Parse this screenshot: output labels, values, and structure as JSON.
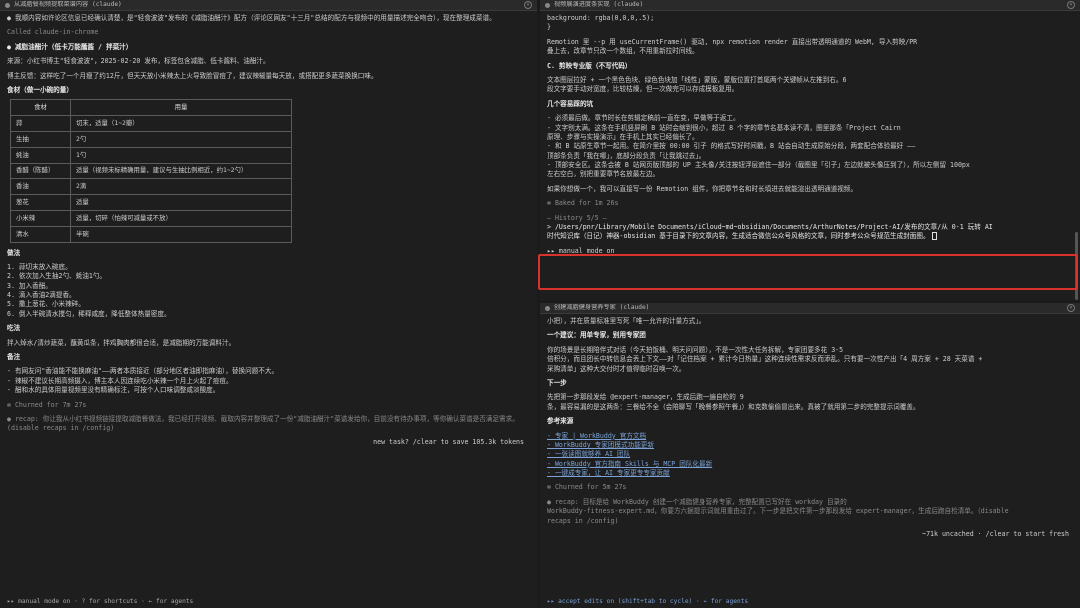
{
  "left_pane": {
    "title": "从减脂餐视频提取菜谱内容 (claude)",
    "lines": [
      {
        "t": "● 我顺内容如许论区信息已经确认清楚，是\"轻食波波\"发布的《减脂油醋汁》配方（评论区网友\"十三月\"总结的配方与视频中的用量描述完全吻合），现在整理成菜谱。",
        "c": "w"
      },
      {
        "t": "",
        "c": "gap"
      },
      {
        "t": "Called claude-in-chrome",
        "c": "dim"
      },
      {
        "t": "",
        "c": "gap"
      },
      {
        "t": "● 减脂油醋汁（低卡万能蘸酱 / 拌菜汁）",
        "c": "bold"
      },
      {
        "t": "",
        "c": "gap"
      },
      {
        "t": "来源：小红书博主\"轻食波波\"，2025-02-20 发布，标签包含减脂、低卡酱料、油醋汁。",
        "c": ""
      },
      {
        "t": "",
        "c": "gap"
      },
      {
        "t": "博主反馈：这样吃了一个月瘦了约12斤，但天天放小米辣太上火导致脸冒痘了，建议辣椒量每天放，或搭配更多蔬菜换换口味。",
        "c": ""
      },
      {
        "t": "",
        "c": "gap"
      },
      {
        "t": "食材（做一小碗的量）",
        "c": "bold"
      }
    ],
    "table": {
      "headers": [
        "食材",
        "用量"
      ],
      "rows": [
        [
          "蒜",
          "切末，适量（1~2瓣）"
        ],
        [
          "生抽",
          "2勺"
        ],
        [
          "蚝油",
          "1勺"
        ],
        [
          "香醋（陈醋）",
          "适量（视频未标精确用量，建议与生抽比例相近，约1~2勺）"
        ],
        [
          "香油",
          "2滴"
        ],
        [
          "葱花",
          "适量"
        ],
        [
          "小米辣",
          "适量，切碎（怕辣可减量或不放）"
        ],
        [
          "清水",
          "半碗"
        ]
      ]
    },
    "lines2": [
      {
        "t": "做法",
        "c": "bold"
      },
      {
        "t": "",
        "c": "gap"
      },
      {
        "t": "1. 蒜切末放入碗底。",
        "c": ""
      },
      {
        "t": "2. 依次加入生抽2勺、蚝油1勺。",
        "c": ""
      },
      {
        "t": "3. 加入香醋。",
        "c": ""
      },
      {
        "t": "4. 滴入香油2滴提香。",
        "c": ""
      },
      {
        "t": "5. 撒上葱花、小米辣碎。",
        "c": ""
      },
      {
        "t": "6. 倒入半碗清水搅匀，稀释咸度，降低整体热量密度。",
        "c": ""
      },
      {
        "t": "",
        "c": "gap"
      },
      {
        "t": "吃法",
        "c": "bold"
      },
      {
        "t": "",
        "c": "gap"
      },
      {
        "t": "拌入焯水/清炒蔬菜，蘸黄瓜条，拌鸡胸肉都很合适，是减脂期的万能调料汁。",
        "c": ""
      },
      {
        "t": "",
        "c": "gap"
      },
      {
        "t": "备注",
        "c": "bold"
      },
      {
        "t": "",
        "c": "gap"
      },
      {
        "t": "- 有网友问\"香油能不能换麻油\"——两者本质接近（部分地区者油即指麻油），替换问题不大。",
        "c": ""
      },
      {
        "t": "- 辣椒不建议长期高频摄入，博主本人因连续吃小米辣一个月上火起了痘痘。",
        "c": ""
      },
      {
        "t": "- 醋和水的具体用量视频里没有精确标注，可按个人口味调整咸淡酸度。",
        "c": ""
      },
      {
        "t": "",
        "c": "gap"
      },
      {
        "t": "✻ Churned for 7m 27s",
        "c": "dim"
      },
      {
        "t": "",
        "c": "gap"
      },
      {
        "t": "● recap: 你让我从小红书视频链接提取减脂餐做法，我已经打开视频、截取内容并整理成了一份\"减脂油醋汁\"菜谱发给你，目前没有待办事项，等你确认菜谱是否满足需求。(disable recaps in /config)",
        "c": "dim w"
      }
    ],
    "hint": "new task? /clear to save 105.3k tokens",
    "status": "▸▸ manual mode on · ? for shortcuts · ← for agents"
  },
  "right_top": {
    "title": "视频展演进度条实现 (claude)",
    "lines": [
      {
        "t": "    background: rgba(0,0,0,.5);",
        "c": ""
      },
      {
        "t": "}",
        "c": ""
      },
      {
        "t": "",
        "c": "gap"
      },
      {
        "t": "Remotion 里 --p 用 useCurrentFrame() 驱动, npx remotion render 直接出带透明通道的 WebM, 导入剪映/PR",
        "c": ""
      },
      {
        "t": "叠上去，改章节只改一个数组，不用重新拉时间线。",
        "c": ""
      },
      {
        "t": "",
        "c": "gap"
      },
      {
        "t": "C. 剪映专业版（不写代码）",
        "c": "bold"
      },
      {
        "t": "",
        "c": "gap"
      },
      {
        "t": "文本图层拉好 + 一个黑色色块、绿色色块加「线性」蒙版，蒙版位置打首尾两个关键帧从左推到右。6",
        "c": ""
      },
      {
        "t": "段文字要手动对宽度，比较枯燥，但一次做完可以存成模板复用。",
        "c": ""
      },
      {
        "t": "",
        "c": "gap"
      },
      {
        "t": "几个容易踩的坑",
        "c": "bold"
      },
      {
        "t": "",
        "c": "gap"
      },
      {
        "t": "- 必须最后做。章节时长在剪辑定稿前一直在变，早做等于返工。",
        "c": ""
      },
      {
        "t": "- 文字别太满。这条在手机竖屏刷 B 站时会缩到很小，超过 8 个字的章节名基本读不清，图里那条「Project Cairn",
        "c": ""
      },
      {
        "t": "原理、步骤与实操演示」在手机上其实已经偏长了。",
        "c": ""
      },
      {
        "t": "- 和 B 站原生章节一起用。在简介里按 00:00 引子 的格式写好时间戳，B 站会自动生成原始分段，两套配合体验最好 ——",
        "c": ""
      },
      {
        "t": "顶部条负责「我在哪」，底部分段负责「让我跳过去」。",
        "c": ""
      },
      {
        "t": "- 顶部安全区。这条会被 B 站网页版顶部的 UP 主头像/关注按钮浮层遮住一部分（截图里「引子」左边就被头像压到了），所以左侧留 100px",
        "c": ""
      },
      {
        "t": "左右空白，别把重要章节名放最左边。",
        "c": ""
      },
      {
        "t": "",
        "c": "gap"
      },
      {
        "t": "如果你想做一个，我可以直接写一份 Remotion 组件，你把章节名和时长填进去就能渲出透明通道视频。",
        "c": ""
      },
      {
        "t": "",
        "c": "gap"
      },
      {
        "t": "✻ Baked for 1m 26s",
        "c": "dim"
      }
    ],
    "history": "— History 5/5 —",
    "prompt_line1": "> /Users/pnr/Library/Mobile Documents/iCloud~md~obsidian/Documents/ArthurNotes/Project-AI/发布的文章/从 0-1 玩转 AI",
    "prompt_line2": "  时代知识库（日记）神器-obsidian 基于目录下的文章内容，生成适合微信公众号风格的文章，同时参考公众号规范生成封面图。",
    "status": "▸▸ manual mode on"
  },
  "right_bottom": {
    "title": "创建减脂健身营养专家 (claude)",
    "lines": [
      {
        "t": "小把），并在质量标准里写死「唯一允许的计量方式」。",
        "c": ""
      },
      {
        "t": "",
        "c": "gap"
      },
      {
        "t": "一个建议：用单专家，别用专家团",
        "c": "bold"
      },
      {
        "t": "",
        "c": "gap"
      },
      {
        "t": "你的场景是长期陪伴式对话（今天拍饭桶、明天问问题），不是一次性大任务拆解，专家团要多花 3-5",
        "c": ""
      },
      {
        "t": "倍积分，而且团长中转信息会丢上下文——对「记住档案 + 累计今日热量」这种连续性需求反而添乱。只有要一次性产出「4 周方案 + 28 天菜谱 +",
        "c": ""
      },
      {
        "t": "采购清单」这种大交付时才值得临时召唤一次。",
        "c": ""
      },
      {
        "t": "",
        "c": "gap"
      },
      {
        "t": "下一步",
        "c": "bold"
      },
      {
        "t": "",
        "c": "gap"
      },
      {
        "t": "先把第一步那段发给 @expert-manager，生成后跑一遍自检的 9",
        "c": ""
      },
      {
        "t": "条，最容易漏的是这两条：三餐给不全（会陪聊写「晚餐参照午餐」）和克数偷偷冒出来。真被了就用第二步的完整提示词覆盖。",
        "c": ""
      },
      {
        "t": "",
        "c": "gap"
      },
      {
        "t": "参考来源",
        "c": "bold"
      }
    ],
    "links": [
      "- 专家 | WorkBuddy 官方文档",
      "- WorkBuddy 专家团模式功能更新",
      "- 一张读图就够养 AI 团队",
      "- WorkBuddy 官方指南 Skills 与 MCP 团队化最新",
      "- 一键成专家，让 AI 专家更专专家贡献"
    ],
    "lines2": [
      {
        "t": "",
        "c": "gap"
      },
      {
        "t": "✻ Churned for 5m 27s",
        "c": "dim"
      },
      {
        "t": "",
        "c": "gap"
      },
      {
        "t": "● recap: 目标是给 WorkBuddy 创建一个减脂健身营养专家，完整配置已写好在 workday 目录的",
        "c": "dim"
      },
      {
        "t": "  WorkBuddy-fitness-expert.md，你要方六据提示词就用重由过了。下一步是把文件第一步那段发给 expert-manager，生成后跑自检清单。（disable",
        "c": "dim"
      },
      {
        "t": "  recaps in /config)",
        "c": "dim"
      }
    ],
    "hint": "~71k uncached · /clear to start fresh",
    "status": "▸▸ accept edits on (shift+tab to cycle) · ← for agents"
  }
}
